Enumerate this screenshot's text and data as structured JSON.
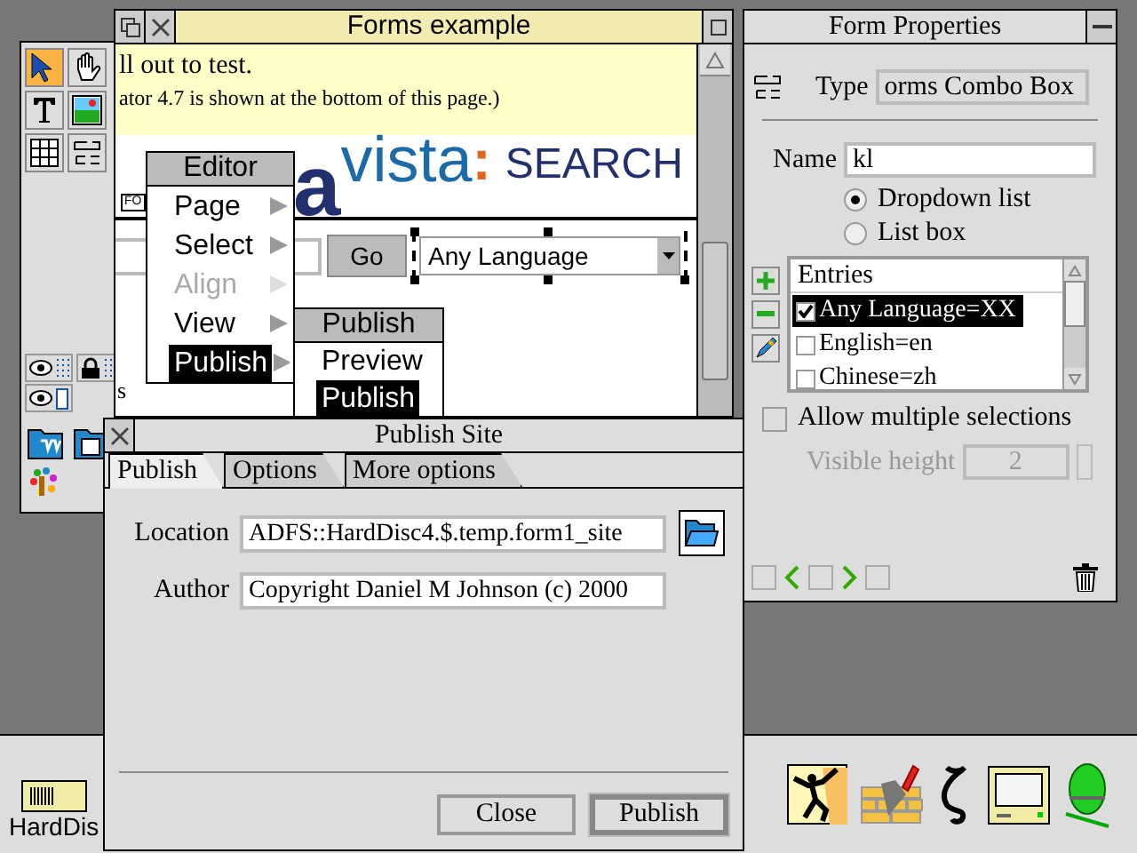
{
  "toolbox": {
    "tools": [
      {
        "kind": "pointer",
        "selected": true
      },
      {
        "kind": "hand",
        "selected": false
      },
      {
        "kind": "text",
        "selected": false
      },
      {
        "kind": "image",
        "selected": false
      },
      {
        "kind": "table",
        "selected": false
      },
      {
        "kind": "form",
        "selected": false
      }
    ]
  },
  "forms_window": {
    "title": "Forms example",
    "text_lines": [
      "ll out to test.",
      "ator 4.7 is shown at the bottom of this page.)"
    ],
    "logo_letter": "a",
    "logo_word": "vista",
    "logo_colon": ":",
    "logo_search": "SEARCH",
    "small_label": "FO",
    "go_button": "Go",
    "language_select": {
      "value": "Any Language",
      "selected": true
    },
    "fragment_text": "s"
  },
  "editor_menu": {
    "title": "Editor",
    "items": [
      {
        "label": "Page",
        "disabled": false,
        "selected": false
      },
      {
        "label": "Select",
        "disabled": false,
        "selected": false
      },
      {
        "label": "Align",
        "disabled": true,
        "selected": false
      },
      {
        "label": "View",
        "disabled": false,
        "selected": false
      },
      {
        "label": "Publish",
        "disabled": false,
        "selected": true
      }
    ]
  },
  "publish_submenu": {
    "title": "Publish",
    "items": [
      {
        "label": "Preview",
        "selected": false
      },
      {
        "label": "Publish",
        "selected": true
      }
    ]
  },
  "form_properties": {
    "title": "Form Properties",
    "type_label": "Type",
    "type_value": "orms Combo Box",
    "name_label": "Name",
    "name_value": "kl",
    "modes": [
      {
        "label": "Dropdown list",
        "selected": true
      },
      {
        "label": "List box",
        "selected": false
      }
    ],
    "entries": {
      "header": "Entries",
      "items": [
        {
          "label": "Any Language=XX",
          "checked": true,
          "selected": true
        },
        {
          "label": "English=en",
          "checked": false,
          "selected": false
        },
        {
          "label": "Chinese=zh",
          "checked": false,
          "selected": false
        }
      ]
    },
    "allow_multiple": {
      "label": "Allow multiple selections",
      "checked": false
    },
    "visible_height": {
      "label": "Visible height",
      "value": "2",
      "disabled": true
    }
  },
  "publish_site": {
    "title": "Publish Site",
    "tabs": [
      {
        "label": "Publish",
        "selected": true
      },
      {
        "label": "Options",
        "selected": false
      },
      {
        "label": "More options",
        "selected": false
      }
    ],
    "fields": [
      {
        "label": "Location",
        "value": "ADFS::HardDisc4.$.temp.form1_site"
      },
      {
        "label": "Author",
        "value": "Copyright Daniel M Johnson (c) 2000"
      }
    ],
    "buttons": [
      {
        "label": "Close",
        "default": false
      },
      {
        "label": "Publish",
        "default": true
      }
    ]
  },
  "icon_bar": {
    "drive_label": "HardDis"
  }
}
